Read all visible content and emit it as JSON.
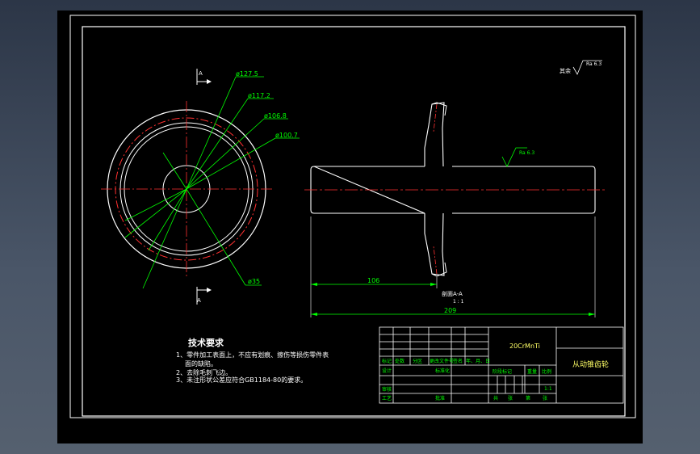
{
  "colors": {
    "background": "#000000",
    "frame": "#ffffff",
    "dimension": "#00ff00",
    "centerline": "#ff2020",
    "title_text": "#ffff66",
    "cell_text": "#00ff00"
  },
  "left_view": {
    "section_mark_top": "A",
    "section_mark_bottom": "A",
    "diameters": [
      "ø127.5",
      "ø117.2",
      "ø106.8",
      "ø100.7",
      "ø35"
    ]
  },
  "right_view": {
    "roughness_main": "Ra 6.3",
    "roughness_other_label": "其余",
    "roughness_other_value": "Ra 6.3",
    "dim_short": "106",
    "dim_total": "209",
    "section_label": "A-A",
    "section_scale": "1 : 1",
    "section_label_prefix": "剖面"
  },
  "tech_requirements": {
    "title": "技术要求",
    "lines": [
      "1、零件加工表面上，不应有划痕、擦伤等损伤零件表",
      "面的缺陷。",
      "2、去除毛刺飞边。",
      "3、未注形状公差应符合GB1184-80的要求。"
    ]
  },
  "title_block": {
    "material": "20CrMnTi",
    "part_name": "从动锥齿轮",
    "headers": [
      "标记",
      "处数",
      "分区",
      "更改文件号",
      "签名",
      "年、月、日"
    ],
    "row_design": [
      "设计",
      "标准化"
    ],
    "stage_headers": [
      "阶段标记",
      "重量",
      "比例"
    ],
    "scale": "1:1",
    "row_review": "审核",
    "row_process": "工艺",
    "row_approve": "批准",
    "sheet_labels": [
      "共",
      "张",
      "第",
      "张"
    ]
  }
}
